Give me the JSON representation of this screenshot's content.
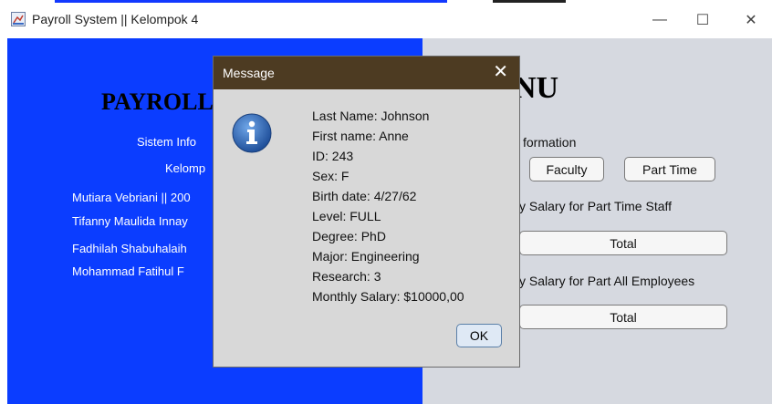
{
  "window": {
    "title": "Payroll System || Kelompok 4",
    "minimize": "—",
    "maximize": "☐",
    "close": "✕"
  },
  "left": {
    "title": "PAYROLL",
    "line1": "Sistem Info",
    "line2": "Kelomp",
    "members": [
      "Mutiara Vebriani || 200",
      "Tifanny Maulida Innay",
      "Fadhilah Shabuhalaih",
      "Mohammad Fatihul F"
    ]
  },
  "right": {
    "title": "NU",
    "info_label": "formation",
    "faculty_button": "Faculty",
    "parttime_button": "Part Time",
    "label_parttime": "y Salary for Part Time Staff",
    "total_button_1": "Total",
    "label_all": "y Salary for Part All Employees",
    "total_button_2": "Total"
  },
  "dialog": {
    "title": "Message",
    "close": "✕",
    "lines": [
      "Last Name: Johnson",
      "First name: Anne",
      "ID: 243",
      "Sex: F",
      "Birth date: 4/27/62",
      "Level: FULL",
      "Degree: PhD",
      "Major: Engineering",
      "Research: 3",
      "Monthly Salary: $10000,00"
    ],
    "ok": "OK"
  }
}
